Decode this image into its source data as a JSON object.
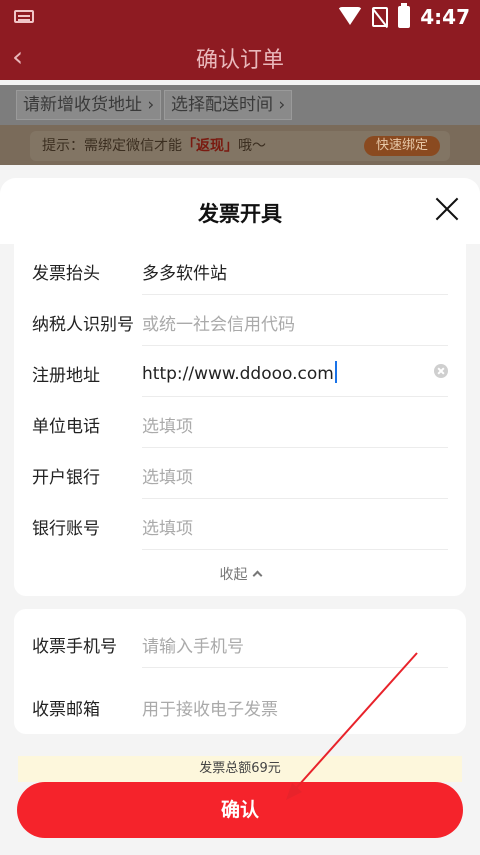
{
  "statusbar": {
    "time": "4:47"
  },
  "appbar": {
    "title": "确认订单",
    "back_icon": "‹"
  },
  "background": {
    "chip_address": "请新增收货地址 ›",
    "chip_delivery": "选择配送时间 ›",
    "tip_prefix": "提示：需绑定微信才能",
    "tip_highlight": "「返现」",
    "tip_suffix": "哦～",
    "tip_button": "快速绑定"
  },
  "sheet": {
    "title": "发票开具",
    "fields": [
      {
        "label": "发票抬头",
        "value": "多多软件站",
        "placeholder": ""
      },
      {
        "label": "纳税人识别号",
        "value": "",
        "placeholder": "或统一社会信用代码"
      },
      {
        "label": "注册地址",
        "value": "http://www.ddooo.com",
        "placeholder": ""
      },
      {
        "label": "单位电话",
        "value": "",
        "placeholder": "选填项"
      },
      {
        "label": "开户银行",
        "value": "",
        "placeholder": "选填项"
      },
      {
        "label": "银行账号",
        "value": "",
        "placeholder": "选填项"
      }
    ],
    "collapse_label": "收起",
    "contact_fields": [
      {
        "label": "收票手机号",
        "value": "",
        "placeholder": "请输入手机号"
      },
      {
        "label": "收票邮箱",
        "value": "",
        "placeholder": "用于接收电子发票"
      }
    ],
    "total_text": "发票总额69元",
    "confirm_label": "确认"
  },
  "colors": {
    "accent": "#f5232b",
    "header": "#8e1b22"
  }
}
